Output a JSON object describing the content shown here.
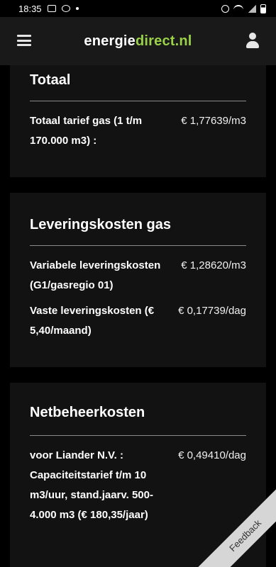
{
  "status_bar": {
    "time": "18:35"
  },
  "header": {
    "logo_part1": "energie",
    "logo_part2": "direct.nl"
  },
  "cards": [
    {
      "title": "Totaal",
      "rows": [
        {
          "label": "Totaal tarief gas (1 t/m 170.000 m3) :",
          "value": "€ 1,77639/m3"
        }
      ]
    },
    {
      "title": "Leveringskosten gas",
      "rows": [
        {
          "label": "Variabele leveringskosten (G1/gasregio 01)",
          "value": "€ 1,28620/m3"
        },
        {
          "label": "Vaste leveringskosten (€ 5,40/maand)",
          "value": "€ 0,17739/dag"
        }
      ]
    },
    {
      "title": "Netbeheerkosten",
      "rows": [
        {
          "label": "voor Liander N.V. : Capaciteitstarief t/m 10 m3/uur, stand.jaarv. 500-4.000 m3 (€ 180,35/jaar)",
          "value": "€ 0,49410/dag"
        }
      ]
    }
  ],
  "feedback_label": "Feedback"
}
